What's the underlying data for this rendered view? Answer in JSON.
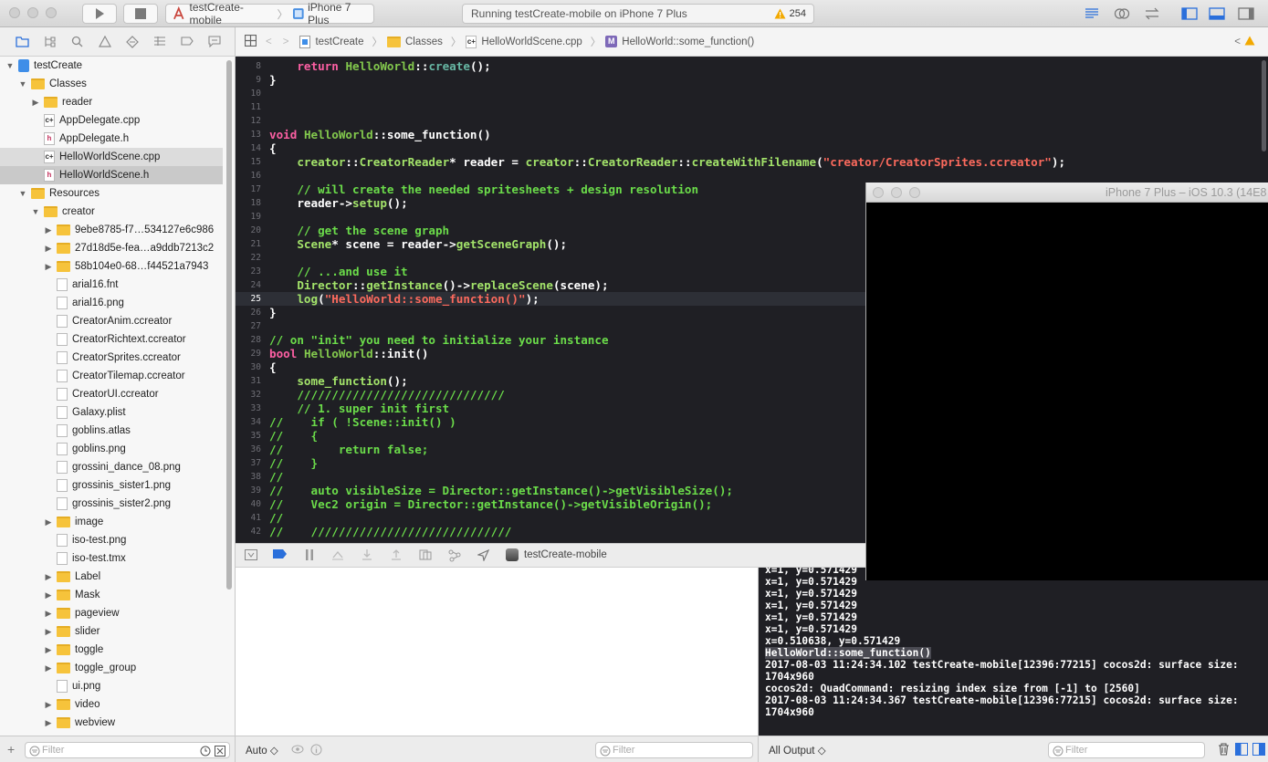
{
  "toolbar": {
    "scheme_target": "testCreate-mobile",
    "device": "iPhone 7 Plus",
    "status_text": "Running testCreate-mobile on iPhone 7 Plus",
    "warning_count": "254"
  },
  "navigator": {
    "project": "testCreate",
    "rows": [
      {
        "label": "testCreate",
        "indent": 0,
        "kind": "project",
        "disclosure": "open"
      },
      {
        "label": "Classes",
        "indent": 1,
        "kind": "folder",
        "disclosure": "open"
      },
      {
        "label": "reader",
        "indent": 2,
        "kind": "folder",
        "disclosure": "closed"
      },
      {
        "label": "AppDelegate.cpp",
        "indent": 2,
        "kind": "cpp",
        "disclosure": ""
      },
      {
        "label": "AppDelegate.h",
        "indent": 2,
        "kind": "h",
        "disclosure": ""
      },
      {
        "label": "HelloWorldScene.cpp",
        "indent": 2,
        "kind": "cpp",
        "disclosure": "",
        "state": "light"
      },
      {
        "label": "HelloWorldScene.h",
        "indent": 2,
        "kind": "h",
        "disclosure": "",
        "state": "sel"
      },
      {
        "label": "Resources",
        "indent": 1,
        "kind": "folder",
        "disclosure": "open"
      },
      {
        "label": "creator",
        "indent": 2,
        "kind": "folder",
        "disclosure": "open"
      },
      {
        "label": "9ebe8785-f7…534127e6c986",
        "indent": 3,
        "kind": "folder",
        "disclosure": "closed"
      },
      {
        "label": "27d18d5e-fea…a9ddb7213c2",
        "indent": 3,
        "kind": "folder",
        "disclosure": "closed"
      },
      {
        "label": "58b104e0-68…f44521a7943",
        "indent": 3,
        "kind": "folder",
        "disclosure": "closed"
      },
      {
        "label": "arial16.fnt",
        "indent": 3,
        "kind": "file",
        "disclosure": ""
      },
      {
        "label": "arial16.png",
        "indent": 3,
        "kind": "file",
        "disclosure": ""
      },
      {
        "label": "CreatorAnim.ccreator",
        "indent": 3,
        "kind": "file",
        "disclosure": ""
      },
      {
        "label": "CreatorRichtext.ccreator",
        "indent": 3,
        "kind": "file",
        "disclosure": ""
      },
      {
        "label": "CreatorSprites.ccreator",
        "indent": 3,
        "kind": "file",
        "disclosure": ""
      },
      {
        "label": "CreatorTilemap.ccreator",
        "indent": 3,
        "kind": "file",
        "disclosure": ""
      },
      {
        "label": "CreatorUI.ccreator",
        "indent": 3,
        "kind": "file",
        "disclosure": ""
      },
      {
        "label": "Galaxy.plist",
        "indent": 3,
        "kind": "file",
        "disclosure": ""
      },
      {
        "label": "goblins.atlas",
        "indent": 3,
        "kind": "file",
        "disclosure": ""
      },
      {
        "label": "goblins.png",
        "indent": 3,
        "kind": "file",
        "disclosure": ""
      },
      {
        "label": "grossini_dance_08.png",
        "indent": 3,
        "kind": "file",
        "disclosure": ""
      },
      {
        "label": "grossinis_sister1.png",
        "indent": 3,
        "kind": "file",
        "disclosure": ""
      },
      {
        "label": "grossinis_sister2.png",
        "indent": 3,
        "kind": "file",
        "disclosure": ""
      },
      {
        "label": "image",
        "indent": 3,
        "kind": "folder",
        "disclosure": "closed"
      },
      {
        "label": "iso-test.png",
        "indent": 3,
        "kind": "file",
        "disclosure": ""
      },
      {
        "label": "iso-test.tmx",
        "indent": 3,
        "kind": "file",
        "disclosure": ""
      },
      {
        "label": "Label",
        "indent": 3,
        "kind": "folder",
        "disclosure": "closed"
      },
      {
        "label": "Mask",
        "indent": 3,
        "kind": "folder",
        "disclosure": "closed"
      },
      {
        "label": "pageview",
        "indent": 3,
        "kind": "folder",
        "disclosure": "closed"
      },
      {
        "label": "slider",
        "indent": 3,
        "kind": "folder",
        "disclosure": "closed"
      },
      {
        "label": "toggle",
        "indent": 3,
        "kind": "folder",
        "disclosure": "closed"
      },
      {
        "label": "toggle_group",
        "indent": 3,
        "kind": "folder",
        "disclosure": "closed"
      },
      {
        "label": "ui.png",
        "indent": 3,
        "kind": "file",
        "disclosure": ""
      },
      {
        "label": "video",
        "indent": 3,
        "kind": "folder",
        "disclosure": "closed"
      },
      {
        "label": "webview",
        "indent": 3,
        "kind": "folder",
        "disclosure": "closed"
      }
    ],
    "filter_placeholder": "Filter"
  },
  "jumpbar": {
    "crumbs": [
      "testCreate",
      "Classes",
      "HelloWorldScene.cpp",
      "HelloWorld::some_function()"
    ],
    "method_badge": "M"
  },
  "editor": {
    "current_line": "25",
    "lines": [
      {
        "n": "8",
        "t": [
          [
            "    ",
            ""
          ],
          [
            "return",
            "kw"
          ],
          [
            " ",
            ""
          ],
          [
            "HelloWorld",
            "tt"
          ],
          [
            "::",
            ""
          ],
          [
            "create",
            "fn"
          ],
          [
            "();",
            ""
          ]
        ]
      },
      {
        "n": "9",
        "t": [
          [
            "}",
            ""
          ]
        ]
      },
      {
        "n": "10",
        "t": []
      },
      {
        "n": "11",
        "t": []
      },
      {
        "n": "12",
        "t": []
      },
      {
        "n": "13",
        "t": [
          [
            "void",
            "kw"
          ],
          [
            " ",
            ""
          ],
          [
            "HelloWorld",
            "tt"
          ],
          [
            "::some_function()",
            ""
          ]
        ]
      },
      {
        "n": "14",
        "t": [
          [
            "{",
            ""
          ]
        ]
      },
      {
        "n": "15",
        "t": [
          [
            "    ",
            ""
          ],
          [
            "creator",
            "mu"
          ],
          [
            "::",
            ""
          ],
          [
            "CreatorReader",
            "mu"
          ],
          [
            "* reader = ",
            ""
          ],
          [
            "creator",
            "mu"
          ],
          [
            "::",
            ""
          ],
          [
            "CreatorReader",
            "mu"
          ],
          [
            "::",
            ""
          ],
          [
            "createWithFilename",
            "mu"
          ],
          [
            "(",
            ""
          ],
          [
            "\"creator/CreatorSprites.ccreator\"",
            "st"
          ],
          [
            ");",
            ""
          ]
        ]
      },
      {
        "n": "16",
        "t": []
      },
      {
        "n": "17",
        "t": [
          [
            "    // will create the needed spritesheets + design resolution",
            "gc"
          ]
        ]
      },
      {
        "n": "18",
        "t": [
          [
            "    reader->",
            ""
          ],
          [
            "setup",
            "mu"
          ],
          [
            "();",
            ""
          ]
        ]
      },
      {
        "n": "19",
        "t": []
      },
      {
        "n": "20",
        "t": [
          [
            "    // get the scene graph",
            "gc"
          ]
        ]
      },
      {
        "n": "21",
        "t": [
          [
            "    ",
            ""
          ],
          [
            "Scene",
            "mu"
          ],
          [
            "* scene = reader->",
            ""
          ],
          [
            "getSceneGraph",
            "mu"
          ],
          [
            "();",
            ""
          ]
        ]
      },
      {
        "n": "22",
        "t": []
      },
      {
        "n": "23",
        "t": [
          [
            "    // ...and use it",
            "gc"
          ]
        ]
      },
      {
        "n": "24",
        "t": [
          [
            "    ",
            ""
          ],
          [
            "Director",
            "mu"
          ],
          [
            "::",
            ""
          ],
          [
            "getInstance",
            "mu"
          ],
          [
            "()->",
            ""
          ],
          [
            "replaceScene",
            "mu"
          ],
          [
            "(scene);",
            ""
          ]
        ]
      },
      {
        "n": "25",
        "t": [
          [
            "    ",
            ""
          ],
          [
            "log",
            "mu"
          ],
          [
            "(",
            ""
          ],
          [
            "\"HelloWorld::some_function()\"",
            "st"
          ],
          [
            ");",
            ""
          ]
        ]
      },
      {
        "n": "26",
        "t": [
          [
            "}",
            ""
          ]
        ]
      },
      {
        "n": "27",
        "t": []
      },
      {
        "n": "28",
        "t": [
          [
            "// on \"init\" you need to initialize your instance",
            "gc"
          ]
        ]
      },
      {
        "n": "29",
        "t": [
          [
            "bool",
            "kw"
          ],
          [
            " ",
            ""
          ],
          [
            "HelloWorld",
            "tt"
          ],
          [
            "::init()",
            ""
          ]
        ]
      },
      {
        "n": "30",
        "t": [
          [
            "{",
            ""
          ]
        ]
      },
      {
        "n": "31",
        "t": [
          [
            "    ",
            ""
          ],
          [
            "some_function",
            "mu"
          ],
          [
            "();",
            ""
          ]
        ]
      },
      {
        "n": "32",
        "t": [
          [
            "    //////////////////////////////",
            "gc"
          ]
        ]
      },
      {
        "n": "33",
        "t": [
          [
            "    // 1. super init first",
            "gc"
          ]
        ]
      },
      {
        "n": "34",
        "t": [
          [
            "//    if ( !Scene::init() )",
            "gc"
          ]
        ]
      },
      {
        "n": "35",
        "t": [
          [
            "//    {",
            "gc"
          ]
        ]
      },
      {
        "n": "36",
        "t": [
          [
            "//        return false;",
            "gc"
          ]
        ]
      },
      {
        "n": "37",
        "t": [
          [
            "//    }",
            "gc"
          ]
        ]
      },
      {
        "n": "38",
        "t": [
          [
            "//",
            "gc"
          ]
        ]
      },
      {
        "n": "39",
        "t": [
          [
            "//    auto visibleSize = Director::getInstance()->getVisibleSize();",
            "gc"
          ]
        ]
      },
      {
        "n": "40",
        "t": [
          [
            "//    Vec2 origin = Director::getInstance()->getVisibleOrigin();",
            "gc"
          ]
        ]
      },
      {
        "n": "41",
        "t": [
          [
            "//",
            "gc"
          ]
        ]
      },
      {
        "n": "42",
        "t": [
          [
            "//    /////////////////////////////",
            "gc"
          ]
        ]
      }
    ]
  },
  "debugbar": {
    "process": "testCreate-mobile"
  },
  "console": {
    "lines": [
      "x=1, y=0.571429",
      "x=1, y=0.571429",
      "x=1, y=0.571429",
      "x=1, y=0.571429",
      "x=1, y=0.571429",
      "x=1, y=0.571429",
      "x=0.510638, y=0.571429",
      "HelloWorld::some_function()",
      "2017-08-03 11:24:34.102 testCreate-mobile[12396:77215] cocos2d: surface size:",
      "1704x960",
      "cocos2d: QuadCommand: resizing index size from [-1] to [2560]",
      "2017-08-03 11:24:34.367 testCreate-mobile[12396:77215] cocos2d: surface size:",
      "1704x960"
    ],
    "highlight_index": 7
  },
  "bottom": {
    "variables_mode": "Auto ◇",
    "vars_filter_placeholder": "Filter",
    "output_mode": "All Output ◇",
    "console_filter_placeholder": "Filter"
  },
  "simulator": {
    "title": "iPhone 7 Plus – iOS 10.3 (14E8"
  },
  "colors": {
    "editor_bg": "#1f1f24",
    "keyword": "#fc5fa3",
    "comment": "#6bdc4a",
    "string": "#fc6a5d",
    "accent": "#2a6fdb",
    "warning": "#f2a900"
  }
}
